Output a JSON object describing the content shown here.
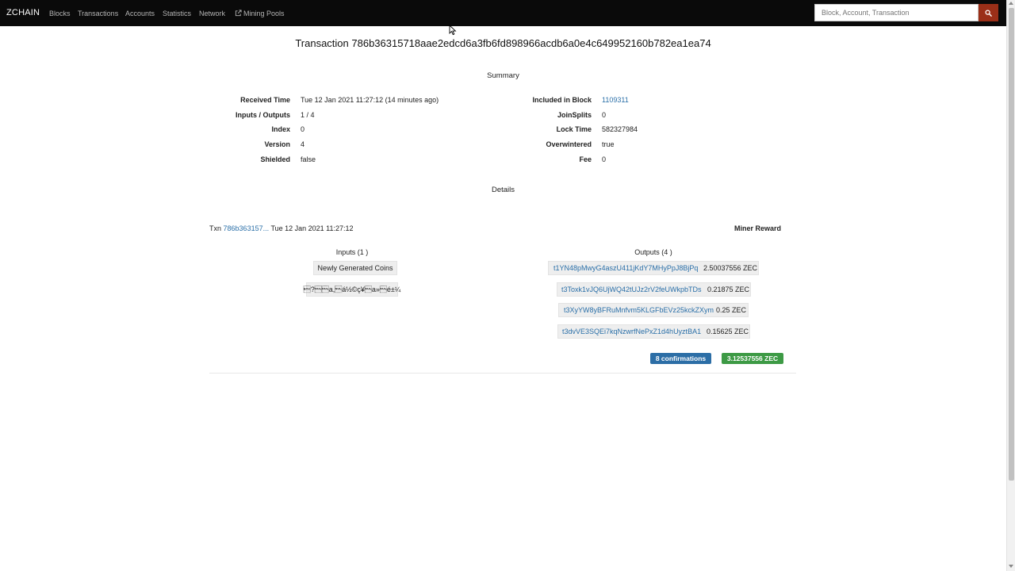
{
  "nav": {
    "brand": "ZCHAIN",
    "links": [
      "Blocks",
      "Transactions",
      "Accounts",
      "Statistics",
      "Network",
      "Mining Pools"
    ],
    "search_placeholder": "Block, Account, Transaction"
  },
  "page_title": "Transaction 786b36315718aae2edcd6a3fb6fd898966acdb6a0e4c649952160b782ea1ea74",
  "summary": {
    "heading": "Summary",
    "left": [
      {
        "label": "Received Time",
        "value": "Tue 12 Jan 2021 11:27:12 (14 minutes ago)"
      },
      {
        "label": "Inputs / Outputs",
        "value": "1 / 4"
      },
      {
        "label": "Index",
        "value": "0"
      },
      {
        "label": "Version",
        "value": "4"
      },
      {
        "label": "Shielded",
        "value": "false"
      }
    ],
    "right": [
      {
        "label": "Included in Block",
        "value": "1109311"
      },
      {
        "label": "JoinSplits",
        "value": "0"
      },
      {
        "label": "Lock Time",
        "value": "582327984"
      },
      {
        "label": "Overwintered",
        "value": "true"
      },
      {
        "label": "Fee",
        "value": "0"
      }
    ]
  },
  "details": {
    "heading": "Details",
    "txn_prefix": "Txn",
    "txn_link": "786b363157...",
    "txn_time": "Tue 12 Jan 2021 11:27:12",
    "miner_reward": "Miner Reward",
    "inputs_heading": "Inputs (1 )",
    "inputs": [
      "Newly Generated Coins",
      "\u0003?\u0000\u0000a,\u0000á½©ç¥\u0000a»\u0000é±¼"
    ],
    "outputs_heading": "Outputs (4 )",
    "outputs": [
      {
        "address": "t1YN48pMwyG4aszU411jKdY7MHyPpJ8BjPq",
        "amount": "2.50037556 ZEC"
      },
      {
        "address": "t3Toxk1vJQ6UjWQ42tUJz2rV2feUWkpbTDs",
        "amount": "0.21875 ZEC"
      },
      {
        "address": "t3XyYW8yBFRuMnfvm5KLGFbEVz25kckZXym",
        "amount": "0.25 ZEC"
      },
      {
        "address": "t3dvVE3SQEi7kqNzwrfNePxZ1d4hUyztBA1",
        "amount": "0.15625 ZEC"
      }
    ],
    "confirmations": "8 confirmations",
    "total": "3.12537556 ZEC"
  },
  "colors": {
    "navbar": "#0a0a0a",
    "search_button": "#9b2f18",
    "link": "#2a6fa8",
    "badge_blue": "#2c6ea6",
    "badge_green": "#3d9a45"
  }
}
